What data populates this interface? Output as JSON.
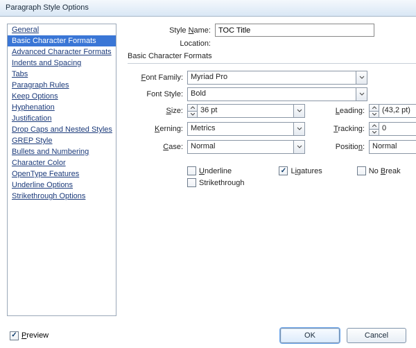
{
  "window": {
    "title": "Paragraph Style Options"
  },
  "sidebar": {
    "items": [
      {
        "label": "General"
      },
      {
        "label": "Basic Character Formats",
        "selected": true
      },
      {
        "label": "Advanced Character Formats"
      },
      {
        "label": "Indents and Spacing"
      },
      {
        "label": "Tabs"
      },
      {
        "label": "Paragraph Rules"
      },
      {
        "label": "Keep Options"
      },
      {
        "label": "Hyphenation"
      },
      {
        "label": "Justification"
      },
      {
        "label": "Drop Caps and Nested Styles"
      },
      {
        "label": "GREP Style"
      },
      {
        "label": "Bullets and Numbering"
      },
      {
        "label": "Character Color"
      },
      {
        "label": "OpenType Features"
      },
      {
        "label": "Underline Options"
      },
      {
        "label": "Strikethrough Options"
      }
    ]
  },
  "header": {
    "styleNameLabel": "Style Name:",
    "styleNameValue": "TOC Title",
    "locationLabel": "Location:",
    "sectionTitle": "Basic Character Formats"
  },
  "form": {
    "fontFamilyLabel": "Font Family:",
    "fontFamilyValue": "Myriad Pro",
    "fontStyleLabel": "Font Style:",
    "fontStyleValue": "Bold",
    "sizeLabel": "Size:",
    "sizeValue": "36 pt",
    "leadingLabel": "Leading:",
    "leadingValue": "(43,2 pt)",
    "kerningLabel": "Kerning:",
    "kerningValue": "Metrics",
    "trackingLabel": "Tracking:",
    "trackingValue": "0",
    "caseLabel": "Case:",
    "caseValue": "Normal",
    "positionLabel": "Position:",
    "positionValue": "Normal"
  },
  "checks": {
    "underline": {
      "label": "Underline",
      "checked": false
    },
    "strikethrough": {
      "label": "Strikethrough",
      "checked": false
    },
    "ligatures": {
      "label": "Ligatures",
      "checked": true
    },
    "nobreak": {
      "label": "No Break",
      "checked": false
    }
  },
  "footer": {
    "previewLabel": "Preview",
    "previewChecked": true,
    "okLabel": "OK",
    "cancelLabel": "Cancel"
  }
}
